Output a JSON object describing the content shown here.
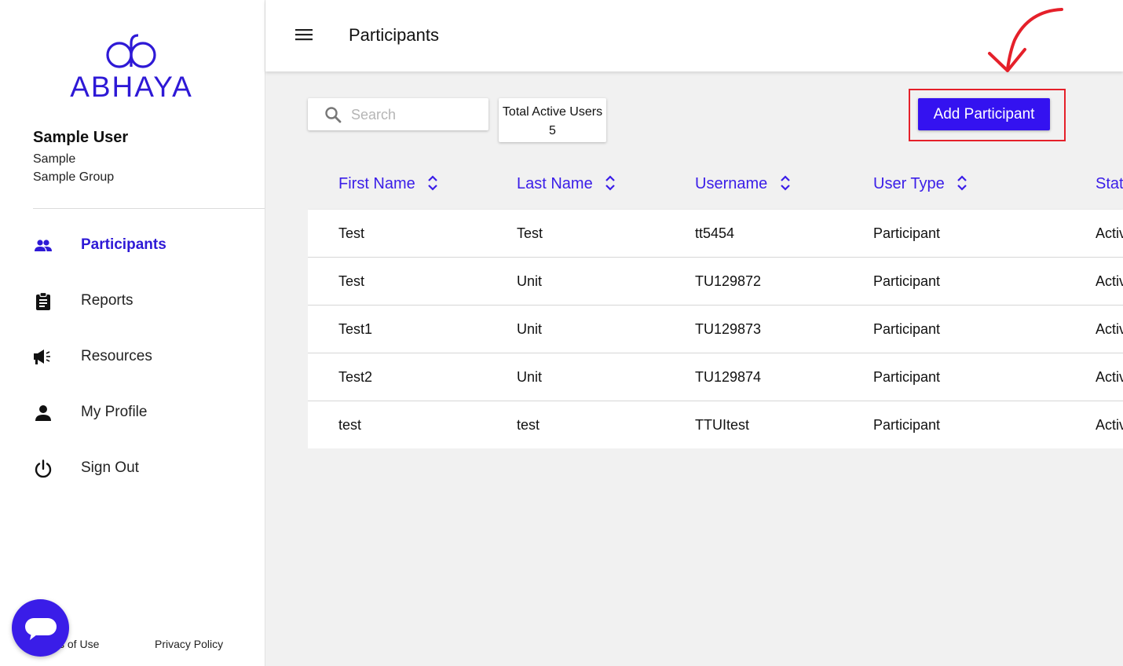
{
  "brand": {
    "name": "ABHAYA",
    "color": "#2e19d6"
  },
  "user": {
    "name": "Sample User",
    "org": "Sample",
    "group": "Sample Group"
  },
  "nav": {
    "items": [
      {
        "label": "Participants",
        "icon": "people-icon",
        "active": true
      },
      {
        "label": "Reports",
        "icon": "clipboard-icon",
        "active": false
      },
      {
        "label": "Resources",
        "icon": "megaphone-icon",
        "active": false
      },
      {
        "label": "My Profile",
        "icon": "person-icon",
        "active": false
      },
      {
        "label": "Sign Out",
        "icon": "power-icon",
        "active": false
      }
    ]
  },
  "footer": {
    "terms": "s of Use",
    "privacy": "Privacy Policy"
  },
  "header": {
    "title": "Participants"
  },
  "toolbar": {
    "search_placeholder": "Search",
    "search_value": "",
    "stat_label": "Total Active Users",
    "stat_value": "5",
    "add_label": "Add Participant"
  },
  "table": {
    "columns": [
      "First Name",
      "Last Name",
      "Username",
      "User Type",
      "Stat"
    ],
    "rows": [
      [
        "Test",
        "Test",
        "tt5454",
        "Participant",
        "Activ"
      ],
      [
        "Test",
        "Unit",
        "TU129872",
        "Participant",
        "Activ"
      ],
      [
        "Test1",
        "Unit",
        "TU129873",
        "Participant",
        "Activ"
      ],
      [
        "Test2",
        "Unit",
        "TU129874",
        "Participant",
        "Activ"
      ],
      [
        "test",
        "test",
        "TTUItest",
        "Participant",
        "Activ"
      ]
    ]
  },
  "colors": {
    "accent": "#3412f0",
    "highlight": "#e5202a"
  }
}
